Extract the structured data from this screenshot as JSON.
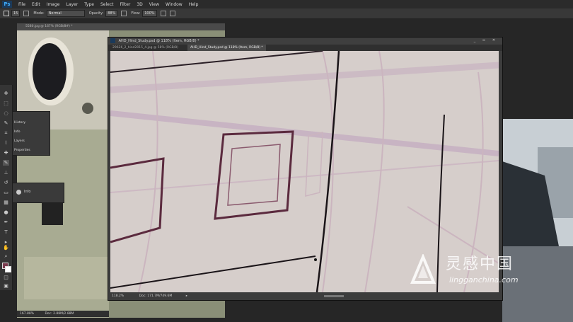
{
  "app": {
    "logo": "Ps"
  },
  "menu": [
    "File",
    "Edit",
    "Image",
    "Layer",
    "Type",
    "Select",
    "Filter",
    "3D",
    "View",
    "Window",
    "Help"
  ],
  "options": {
    "size_value": "15",
    "mode_label": "Mode:",
    "mode_value": "Normal",
    "opacity_label": "Opacity:",
    "opacity_value": "88%",
    "flow_label": "Flow:",
    "flow_value": "100%"
  },
  "photo_window": {
    "title": "5580.jpg @ 167% (RGB/8#) *"
  },
  "side_panel": {
    "items": [
      "History",
      "Info",
      "Layers",
      "Properties"
    ]
  },
  "info_panel": {
    "label": "Info"
  },
  "main_window": {
    "title": "AHD_Hind_Study.psd @ 118% (Item, RGB/8) *",
    "tabs": [
      "29626_2_hind2015_4.jpg @ 58% (RGB/8)",
      "AHD_Hind_Study.psd @ 118% (Item, RGB/8) *"
    ],
    "status_zoom": "118.2%",
    "status_doc": "Doc: 171.7M/749.6M"
  },
  "left_window": {
    "status_zoom": "167.88%",
    "status_doc": "Doc: 2.88M/2.88M"
  },
  "watermark": {
    "cn": "灵感中国",
    "en": "lingganchina.com"
  },
  "colors": {
    "foreground": "#7a3b4e",
    "background": "#ffffff",
    "canvas": "#d6cecb"
  }
}
